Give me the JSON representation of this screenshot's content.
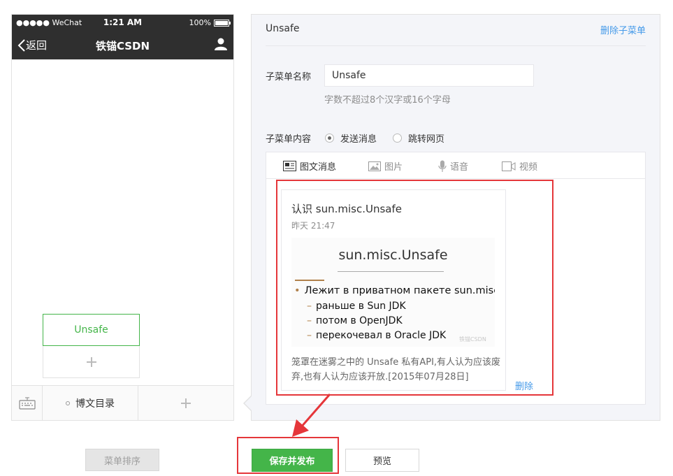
{
  "phone": {
    "status_left": "●●●●● WeChat",
    "status_time": "1:21 AM",
    "status_battery": "100%",
    "back_label": "返回",
    "account_name": "铁锚CSDN",
    "sub_menu_item": "Unsafe",
    "main_menu_item": "博文目录"
  },
  "editor": {
    "title": "Unsafe",
    "delete_submenu": "删除子菜单",
    "name_label": "子菜单名称",
    "name_value": "Unsafe",
    "name_hint": "字数不超过8个汉字或16个字母",
    "content_label": "子菜单内容",
    "radio_send": "发送消息",
    "radio_jump": "跳转网页",
    "tabs": [
      "图文消息",
      "图片",
      "语音",
      "视频"
    ]
  },
  "article": {
    "title": "认识 sun.misc.Unsafe",
    "time": "昨天 21:47",
    "cover_heading": "sun.misc.Unsafe",
    "cover_lines": [
      "Лежит в приватном пакете sun.misc",
      "раньше в Sun JDK",
      "потом в OpenJDK",
      "перекочевал в Oracle JDK"
    ],
    "cover_watermark": "铁锚CSDN",
    "digest": "笼罩在迷雾之中的 Unsafe 私有API,有人认为应该废弃,也有人认为应该开放.[2015年07月28日]",
    "delete_label": "删除"
  },
  "buttons": {
    "sort": "菜单排序",
    "save": "保存并发布",
    "preview": "预览"
  },
  "colors": {
    "accent_green": "#44b549",
    "link_blue": "#459ae9",
    "highlight_red": "#e5363a",
    "navbar_dark": "#2f2f2f"
  }
}
